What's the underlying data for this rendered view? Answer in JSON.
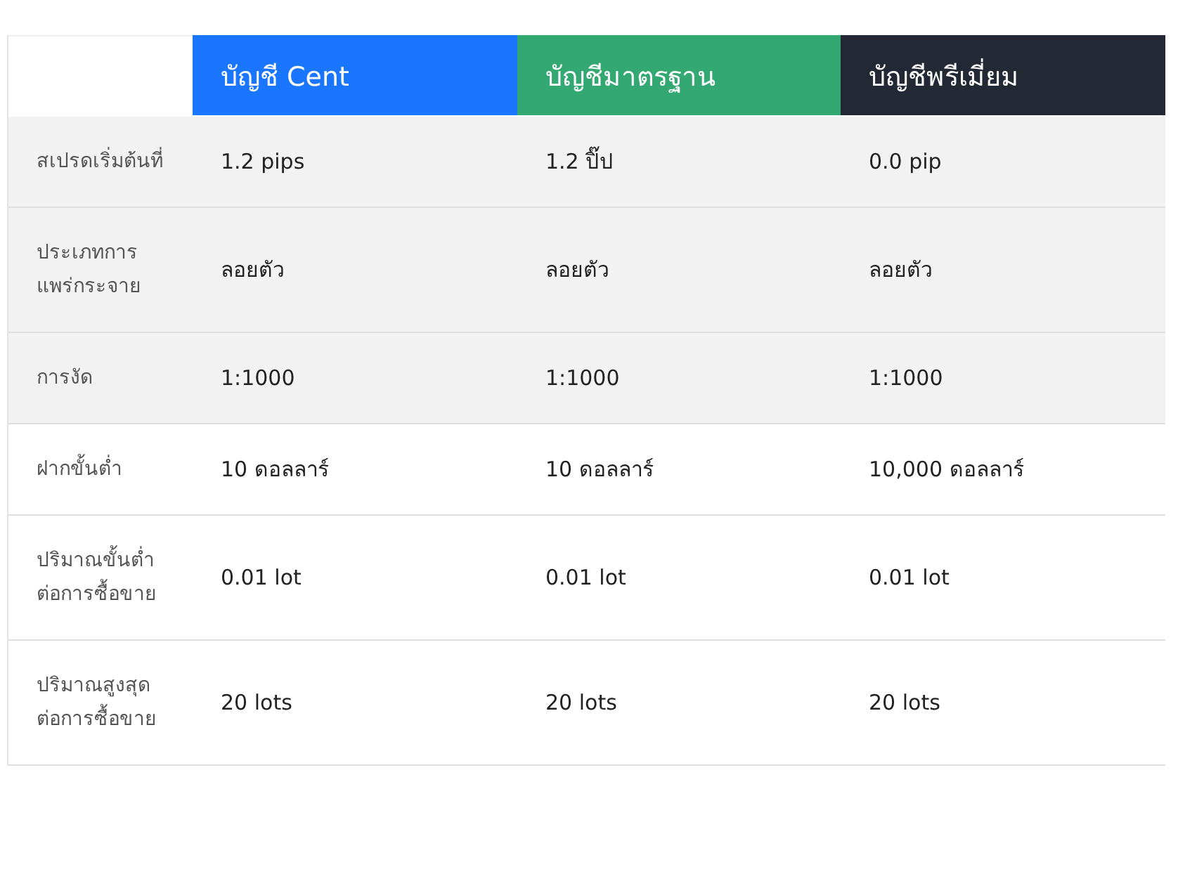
{
  "table": {
    "columns": [
      {
        "label": "บัญชี Cent",
        "color": "#1a76ff"
      },
      {
        "label": "บัญชีมาตรฐาน",
        "color": "#33a872"
      },
      {
        "label": "บัญชีพรีเมี่ยม",
        "color": "#222834"
      }
    ],
    "rows": [
      {
        "label": "สเปรดเริ่มต้นที่",
        "shaded": true,
        "values": [
          "1.2 pips",
          "1.2 ปิ๊ป",
          "0.0 pip"
        ]
      },
      {
        "label": "ประเภทการแพร่กระจาย",
        "shaded": true,
        "values": [
          "ลอยตัว",
          "ลอยตัว",
          "ลอยตัว"
        ]
      },
      {
        "label": "การงัด",
        "shaded": true,
        "values": [
          "1:1000",
          "1:1000",
          "1:1000"
        ]
      },
      {
        "label": "ฝากขั้นต่ำ",
        "shaded": false,
        "values": [
          "10 ดอลลาร์",
          "10 ดอลลาร์",
          "10,000 ดอลลาร์"
        ]
      },
      {
        "label": "ปริมาณขั้นต่ำต่อการซื้อขาย",
        "shaded": false,
        "values": [
          "0.01 lot",
          "0.01 lot",
          "0.01 lot"
        ]
      },
      {
        "label": "ปริมาณสูงสุดต่อการซื้อขาย",
        "shaded": false,
        "values": [
          "20 lots",
          "20 lots",
          "20 lots"
        ]
      }
    ]
  }
}
